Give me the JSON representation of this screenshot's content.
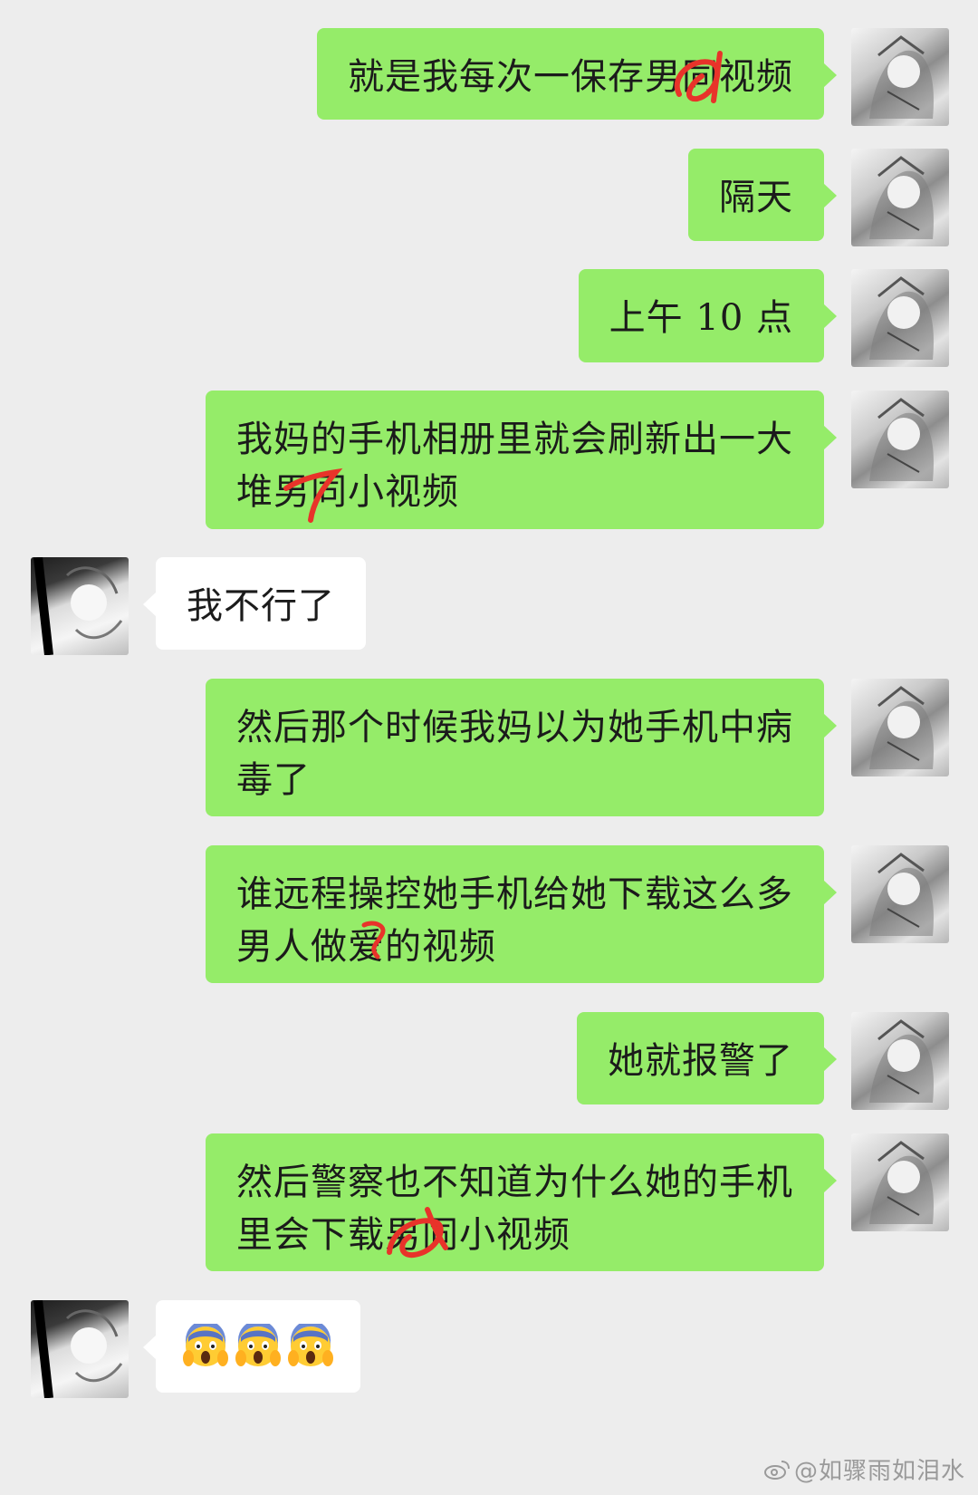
{
  "chat": {
    "messages": [
      {
        "side": "sent",
        "lines": [
          "就是我每次一保存男同视频"
        ]
      },
      {
        "side": "sent",
        "lines": [
          "隔天"
        ]
      },
      {
        "side": "sent",
        "lines": [
          "上午 10 点"
        ]
      },
      {
        "side": "sent",
        "lines": [
          "我妈的手机相册里就会刷新出一大",
          "堆男同小视频"
        ]
      },
      {
        "side": "received",
        "lines": [
          "我不行了"
        ]
      },
      {
        "side": "sent",
        "lines": [
          "然后那个时候我妈以为她手机中病",
          "毒了"
        ]
      },
      {
        "side": "sent",
        "lines": [
          "谁远程操控她手机给她下载这么多",
          "男人做爱的视频"
        ]
      },
      {
        "side": "sent",
        "lines": [
          "她就报警了"
        ]
      },
      {
        "side": "sent",
        "lines": [
          "然后警察也不知道为什么她的手机",
          "里会下载男同小视频"
        ]
      },
      {
        "side": "received",
        "emojis": [
          "screaming-face",
          "screaming-face",
          "screaming-face"
        ]
      }
    ]
  },
  "watermark": {
    "text": "@如骤雨如泪水"
  },
  "colors": {
    "background": "#ededed",
    "sent_bubble": "#95ec69",
    "received_bubble": "#ffffff",
    "scribble": "#e8332a"
  }
}
